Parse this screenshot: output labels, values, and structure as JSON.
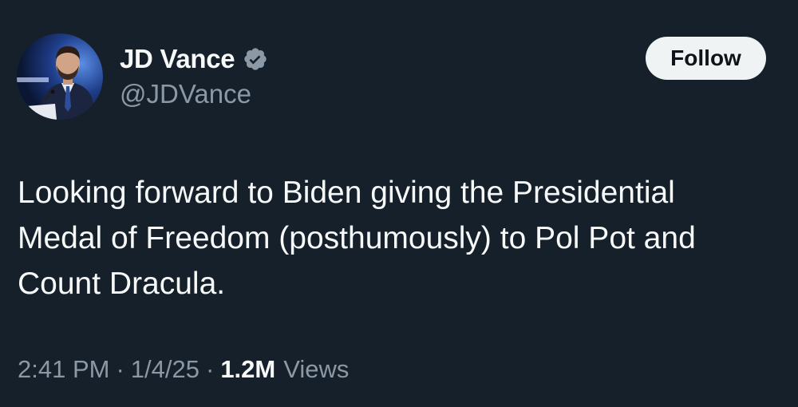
{
  "author": {
    "display_name": "JD Vance",
    "handle": "@JDVance",
    "verified_icon": "verified-badge-icon"
  },
  "actions": {
    "follow_label": "Follow"
  },
  "tweet": {
    "lines": [
      "Looking forward to Biden giving the Presidential",
      "Medal of Freedom (posthumously) to Pol Pot and",
      "Count Dracula."
    ]
  },
  "meta": {
    "time": "2:41 PM",
    "separator": "·",
    "date": "1/4/25",
    "views_count": "1.2M",
    "views_label": "Views"
  },
  "colors": {
    "background": "#15202b",
    "text_primary": "#f7f9f9",
    "text_secondary": "#8b98a5",
    "button_bg": "#eff3f4",
    "verified_badge": "#8b98a5"
  }
}
